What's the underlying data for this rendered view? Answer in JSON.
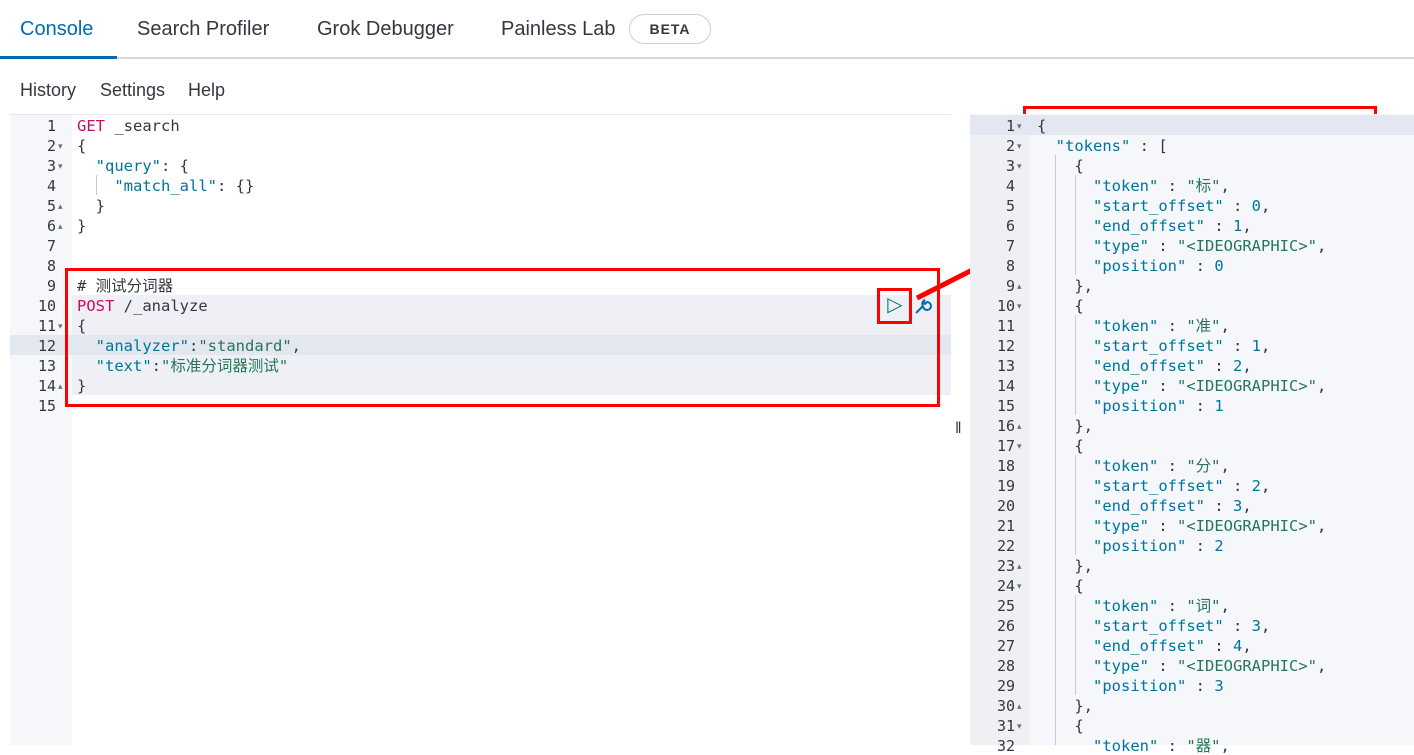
{
  "tabs": [
    {
      "label": "Console",
      "active": true
    },
    {
      "label": "Search Profiler",
      "active": false
    },
    {
      "label": "Grok Debugger",
      "active": false
    },
    {
      "label": "Painless Lab",
      "active": false
    }
  ],
  "beta_badge": "BETA",
  "submenu": {
    "history": "History",
    "settings": "Settings",
    "help": "Help"
  },
  "request_editor": {
    "line_numbers": [
      "1",
      "2",
      "3",
      "4",
      "5",
      "6",
      "7",
      "8",
      "9",
      "10",
      "11",
      "12",
      "13",
      "14",
      "15"
    ],
    "lines": [
      "GET _search",
      "{",
      "  \"query\": {",
      "    \"match_all\": {}",
      "  }",
      "}",
      "",
      "",
      "# 测试分词器",
      "POST /_analyze",
      "{",
      "  \"analyzer\":\"standard\",",
      "  \"text\":\"标准分词器测试\"",
      "}",
      ""
    ]
  },
  "response_editor": {
    "line_numbers": [
      "1",
      "2",
      "3",
      "4",
      "5",
      "6",
      "7",
      "8",
      "9",
      "10",
      "11",
      "12",
      "13",
      "14",
      "15",
      "16",
      "17",
      "18",
      "19",
      "20",
      "21",
      "22",
      "23",
      "24",
      "25",
      "26",
      "27",
      "28",
      "29",
      "30",
      "31",
      "32"
    ],
    "lines": [
      "{",
      "  \"tokens\" : [",
      "    {",
      "      \"token\" : \"标\",",
      "      \"start_offset\" : 0,",
      "      \"end_offset\" : 1,",
      "      \"type\" : \"<IDEOGRAPHIC>\",",
      "      \"position\" : 0",
      "    },",
      "    {",
      "      \"token\" : \"准\",",
      "      \"start_offset\" : 1,",
      "      \"end_offset\" : 2,",
      "      \"type\" : \"<IDEOGRAPHIC>\",",
      "      \"position\" : 1",
      "    },",
      "    {",
      "      \"token\" : \"分\",",
      "      \"start_offset\" : 2,",
      "      \"end_offset\" : 3,",
      "      \"type\" : \"<IDEOGRAPHIC>\",",
      "      \"position\" : 2",
      "    },",
      "    {",
      "      \"token\" : \"词\",",
      "      \"start_offset\" : 3,",
      "      \"end_offset\" : 4,",
      "      \"type\" : \"<IDEOGRAPHIC>\",",
      "      \"position\" : 3",
      "    },",
      "    {",
      "      \"token\" : \"器\","
    ]
  },
  "splitter_glyph": "‖",
  "play_icon": "▷",
  "wrench_icon": "wrench-icon",
  "colors": {
    "accent": "#006bb4",
    "annotation_red": "#ff0000",
    "keyword": "#c80a68",
    "string": "#00749b",
    "value": "#25765b"
  }
}
